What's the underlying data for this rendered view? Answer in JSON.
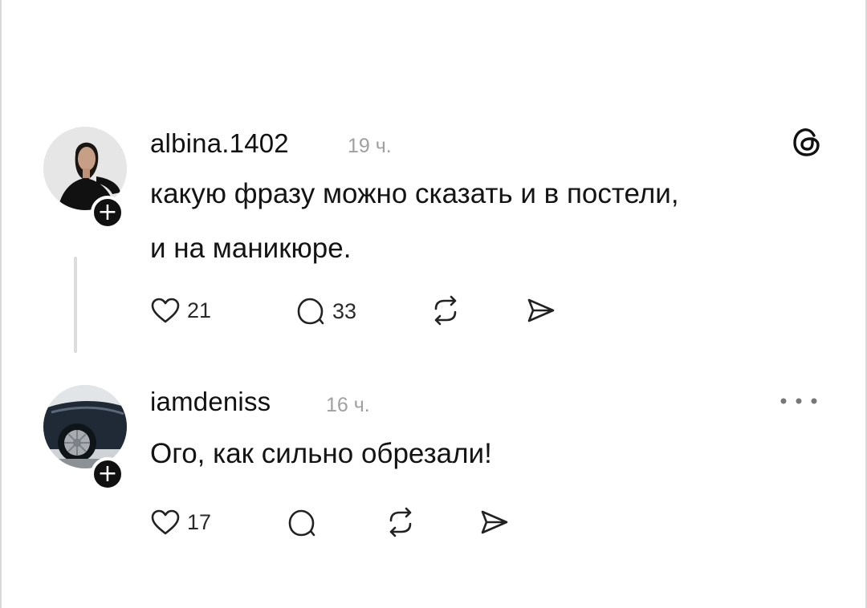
{
  "posts": [
    {
      "username": "albina.1402",
      "time": "19 ч.",
      "text_lines": [
        "какую фразу можно сказать и в постели,",
        "и на маникюре."
      ],
      "likes": "21",
      "replies": "33",
      "top_right_icon": "threads-logo-icon",
      "avatar": "woman-portrait"
    },
    {
      "username": "iamdeniss",
      "time": "16 ч.",
      "text_lines": [
        "Ого, как сильно обрезали!"
      ],
      "likes": "17",
      "replies": "",
      "top_right_icon": "more-options-icon",
      "avatar": "car-wheel-photo"
    }
  ],
  "follow_badge_symbol": "+",
  "colors": {
    "text": "#111111",
    "muted": "#a0a0a0",
    "thread_line": "#dcdcdc",
    "badge": "#111111"
  }
}
